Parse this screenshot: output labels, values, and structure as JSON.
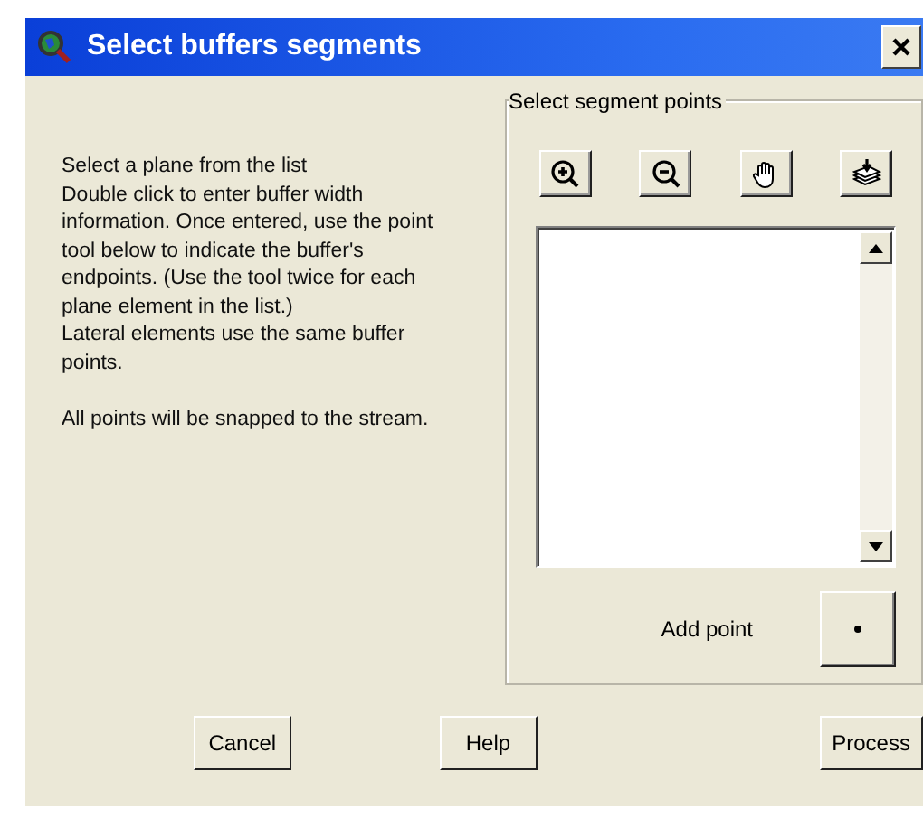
{
  "window": {
    "title": "Select buffers segments"
  },
  "instructions": [
    [
      "Select a plane from the list",
      "Double click to enter buffer width information. Once entered, use the point tool below to indicate the buffer's endpoints. (Use the tool twice for each plane element in the list.)",
      "Lateral elements use the same buffer points."
    ],
    [
      "All points will be snapped to the stream."
    ]
  ],
  "group": {
    "title": "Select segment points",
    "tools": [
      {
        "kind": "zoom-in"
      },
      {
        "kind": "zoom-out"
      },
      {
        "kind": "pan"
      },
      {
        "kind": "add-layer"
      }
    ],
    "add_point_label": "Add point"
  },
  "buttons": [
    "Cancel",
    "Help",
    "Process"
  ]
}
